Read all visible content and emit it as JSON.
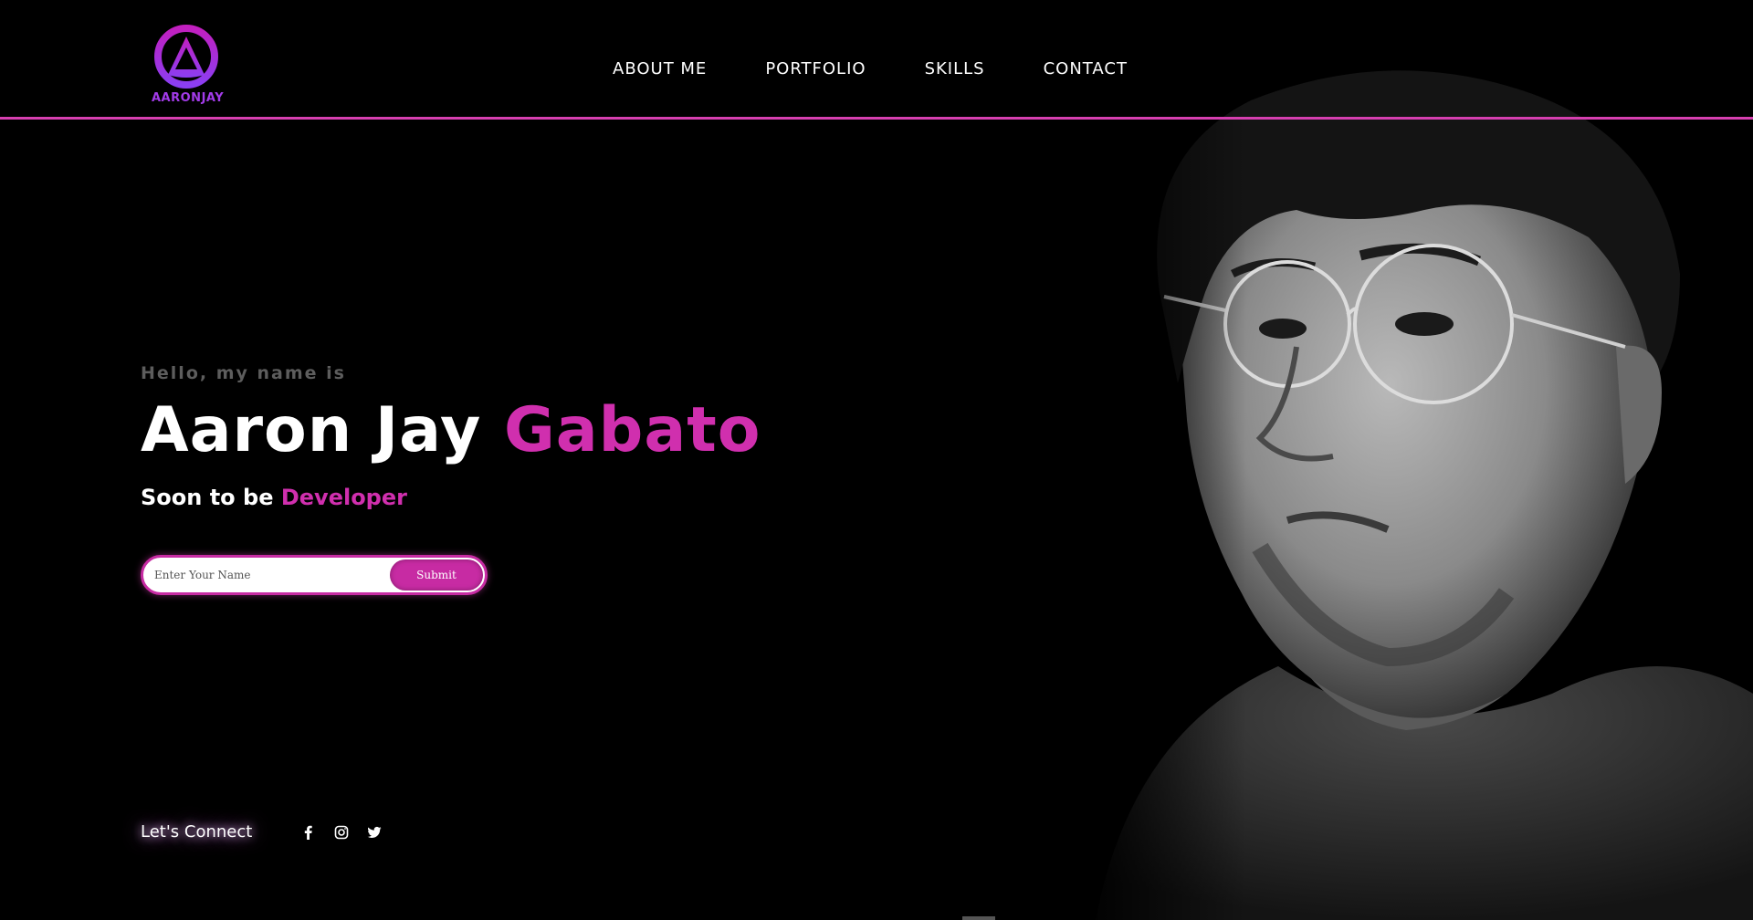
{
  "brand": {
    "logo_text": "AARONJAY",
    "colors": {
      "accent": "#d02fae",
      "logo_gradient_start": "#c21fbf",
      "logo_gradient_end": "#8b3ef2",
      "border": "#d63fb0"
    }
  },
  "nav": {
    "items": [
      {
        "label": "ABOUT ME"
      },
      {
        "label": "PORTFOLIO"
      },
      {
        "label": "SKILLS"
      },
      {
        "label": "CONTACT"
      }
    ]
  },
  "hero": {
    "greeting": "Hello, my name is",
    "name_first": "Aaron Jay",
    "name_last": "Gabato",
    "tagline_prefix": "Soon to be",
    "tagline_accent": "Developer"
  },
  "form": {
    "placeholder": "Enter Your Name",
    "submit_label": "Submit"
  },
  "connect": {
    "label": "Let's Connect",
    "icons": [
      "facebook-icon",
      "instagram-icon",
      "twitter-icon"
    ]
  },
  "portrait": {
    "icon": "profile-photo"
  }
}
